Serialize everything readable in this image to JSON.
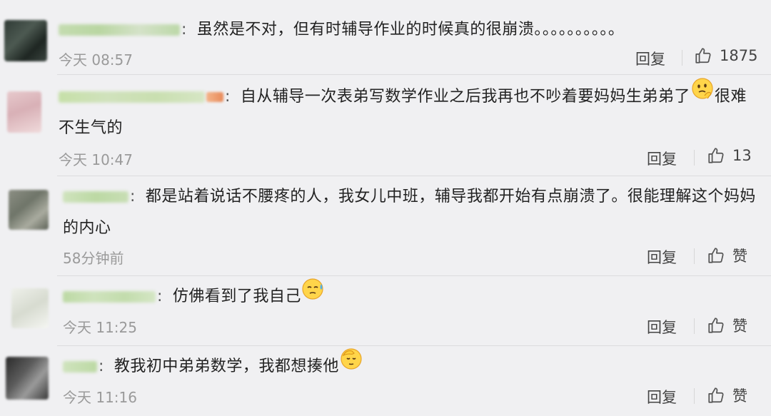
{
  "comments": [
    {
      "text": "虽然是不对，但有时辅导作业的时候真的很崩溃。。。。。。。。。。",
      "time": "今天 08:57",
      "reply_label": "回复",
      "like_label": "1875"
    },
    {
      "text_line1": "自从辅导一次表弟写数学作业之后我再也不吵着要妈妈生弟弟了",
      "text_after_emoji": "很难",
      "text_line2": "不生气的",
      "time": "今天 10:47",
      "reply_label": "回复",
      "like_label": "13",
      "emoji_icon": "thinking-face-icon"
    },
    {
      "text_line1": "都是站着说话不腰疼的人，我女儿中班，辅导我都开始有点崩溃了。很能理解这个妈妈",
      "text_line2": "的内心",
      "time": "58分钟前",
      "reply_label": "回复",
      "like_label": "赞"
    },
    {
      "text": "仿佛看到了我自己",
      "time": "今天 11:25",
      "reply_label": "回复",
      "like_label": "赞",
      "emoji_icon": "sweat-face-icon"
    },
    {
      "text": "教我初中弟弟数学，我都想揍他",
      "time": "今天 11:16",
      "reply_label": "回复",
      "like_label": "赞",
      "emoji_icon": "facepalm-face-icon"
    }
  ],
  "colors": {
    "background": "#f0f0f2",
    "username_green": "#b8d8a0",
    "meta_gray": "#9a9a9a"
  }
}
